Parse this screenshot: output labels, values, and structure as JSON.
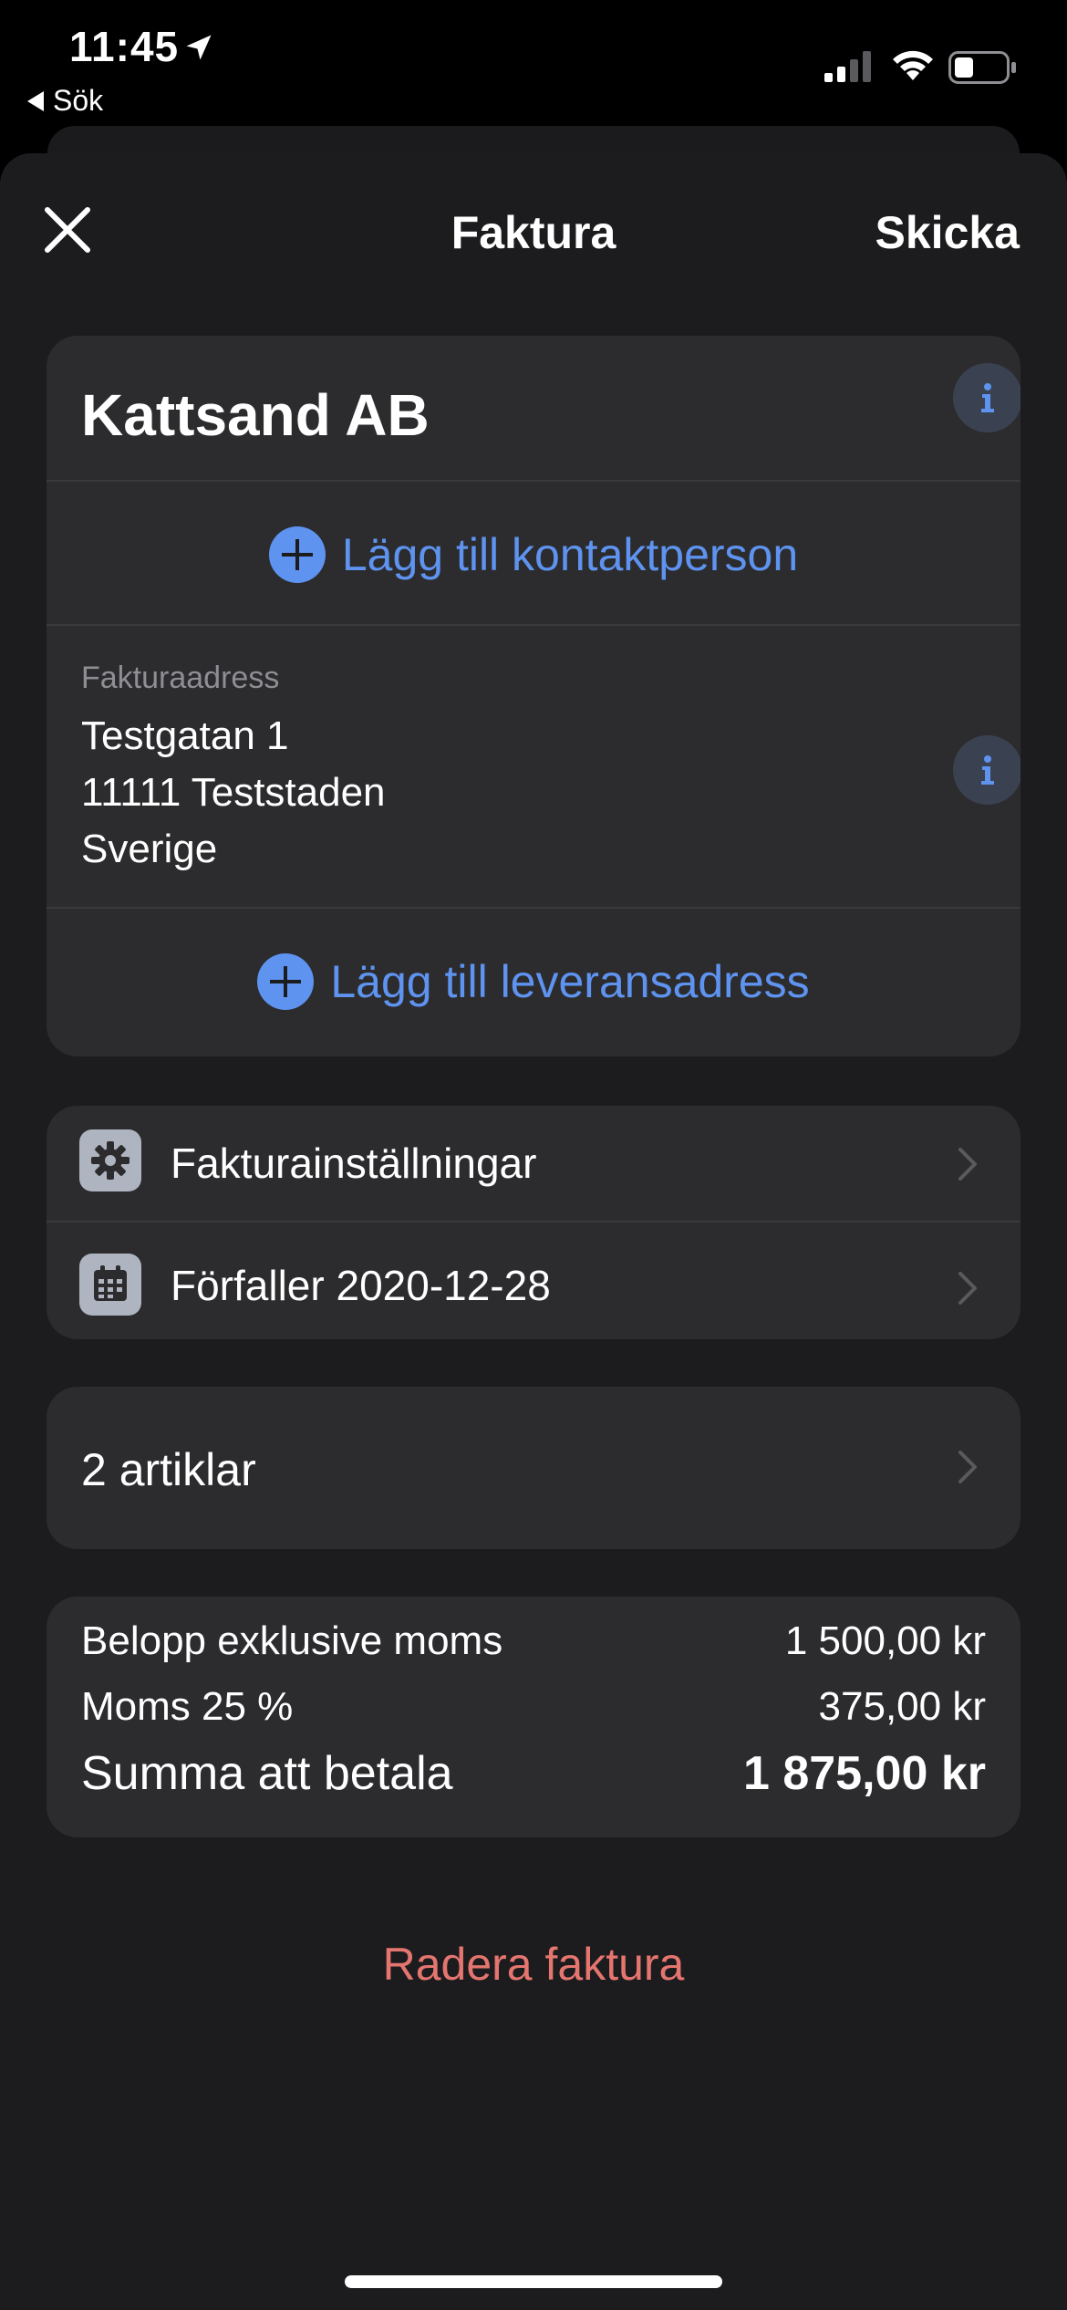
{
  "status_bar": {
    "time": "11:45",
    "back_label": "Sök"
  },
  "nav": {
    "title": "Faktura",
    "send_label": "Skicka"
  },
  "customer": {
    "name": "Kattsand AB",
    "add_contact_label": "Lägg till kontaktperson",
    "address_label": "Fakturaadress",
    "address_lines": [
      "Testgatan 1",
      "11111 Teststaden",
      "Sverige"
    ],
    "add_delivery_label": "Lägg till leveransadress"
  },
  "settings": {
    "items": [
      {
        "label": "Fakturainställningar",
        "icon": "gear-icon"
      },
      {
        "label": "Förfaller 2020-12-28",
        "icon": "calendar-icon"
      }
    ]
  },
  "articles": {
    "label": "2 artiklar"
  },
  "totals": {
    "rows": [
      {
        "label": "Belopp exklusive moms",
        "value": "1 500,00 kr"
      },
      {
        "label": "Moms 25 %",
        "value": "375,00 kr"
      },
      {
        "label": "Summa att betala",
        "value": "1 875,00 kr"
      }
    ]
  },
  "actions": {
    "delete_label": "Radera faktura"
  },
  "colors": {
    "accent": "#5e93f0",
    "destructive": "#e4756f",
    "card": "#2c2c2e",
    "background": "#1c1c1e"
  }
}
